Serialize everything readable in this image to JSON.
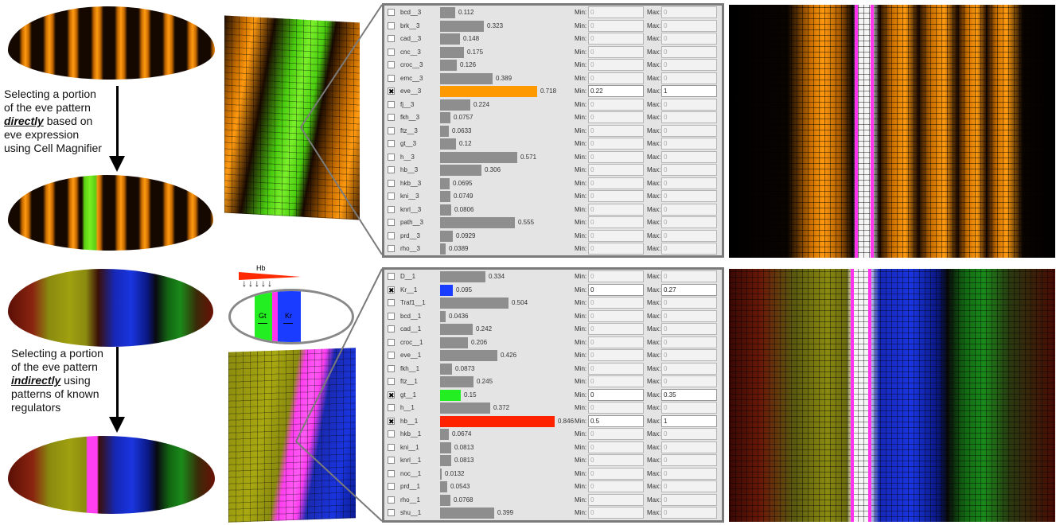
{
  "colors": {
    "orange": "#ff9900",
    "blue": "#1a3cff",
    "green": "#22ee22",
    "red": "#ff2200",
    "magenta": "#ff33ee",
    "bar_gray": "#8e8e8e"
  },
  "captions": {
    "top": {
      "line1": "Selecting a portion",
      "line2": "of the eve pattern",
      "emph": "directly",
      "line3_rest": " based on",
      "line4": "eve expression",
      "line5": "using Cell Magnifier"
    },
    "bottom": {
      "line1": "Selecting a portion",
      "line2": "of the eve pattern",
      "emph": "indirectly",
      "line3_rest": " using",
      "line4": "patterns of known",
      "line5": "regulators"
    }
  },
  "schematic": {
    "gradient_label": "Hb",
    "gt_label": "Gt",
    "kr_label": "Kr"
  },
  "panel_top": {
    "min_label": "Min:",
    "max_label": "Max:",
    "rows": [
      {
        "name": "bcd__3",
        "value": "0.112",
        "checked": "",
        "min": "0",
        "max": "0"
      },
      {
        "name": "brk__3",
        "value": "0.323",
        "checked": "",
        "min": "0",
        "max": "0"
      },
      {
        "name": "cad__3",
        "value": "0.148",
        "checked": "",
        "min": "0",
        "max": "0"
      },
      {
        "name": "cnc__3",
        "value": "0.175",
        "checked": "",
        "min": "0",
        "max": "0"
      },
      {
        "name": "croc__3",
        "value": "0.126",
        "checked": "",
        "min": "0",
        "max": "0"
      },
      {
        "name": "emc__3",
        "value": "0.389",
        "checked": "",
        "min": "0",
        "max": "0"
      },
      {
        "name": "eve__3",
        "value": "0.718",
        "checked": "✖",
        "min": "0.22",
        "max": "1",
        "color": "#ff9900"
      },
      {
        "name": "fj__3",
        "value": "0.224",
        "checked": "",
        "min": "0",
        "max": "0"
      },
      {
        "name": "fkh__3",
        "value": "0.0757",
        "checked": "",
        "min": "0",
        "max": "0"
      },
      {
        "name": "ftz__3",
        "value": "0.0633",
        "checked": "",
        "min": "0",
        "max": "0"
      },
      {
        "name": "gt__3",
        "value": "0.12",
        "checked": "",
        "min": "0",
        "max": "0"
      },
      {
        "name": "h__3",
        "value": "0.571",
        "checked": "",
        "min": "0",
        "max": "0"
      },
      {
        "name": "hb__3",
        "value": "0.306",
        "checked": "",
        "min": "0",
        "max": "0"
      },
      {
        "name": "hkb__3",
        "value": "0.0695",
        "checked": "",
        "min": "0",
        "max": "0"
      },
      {
        "name": "kni__3",
        "value": "0.0749",
        "checked": "",
        "min": "0",
        "max": "0"
      },
      {
        "name": "knrl__3",
        "value": "0.0806",
        "checked": "",
        "min": "0",
        "max": "0"
      },
      {
        "name": "path__3",
        "value": "0.555",
        "checked": "",
        "min": "0",
        "max": "0"
      },
      {
        "name": "prd__3",
        "value": "0.0929",
        "checked": "",
        "min": "0",
        "max": "0"
      },
      {
        "name": "rho__3",
        "value": "0.0389",
        "checked": "",
        "min": "0",
        "max": "0"
      }
    ]
  },
  "panel_bottom": {
    "min_label": "Min:",
    "max_label": "Max:",
    "rows": [
      {
        "name": "D__1",
        "value": "0.334",
        "checked": "",
        "min": "0",
        "max": "0"
      },
      {
        "name": "Kr__1",
        "value": "0.095",
        "checked": "✖",
        "min": "0",
        "max": "0.27",
        "color": "#1a3cff"
      },
      {
        "name": "Traf1__1",
        "value": "0.504",
        "checked": "",
        "min": "0",
        "max": "0"
      },
      {
        "name": "bcd__1",
        "value": "0.0436",
        "checked": "",
        "min": "0",
        "max": "0"
      },
      {
        "name": "cad__1",
        "value": "0.242",
        "checked": "",
        "min": "0",
        "max": "0"
      },
      {
        "name": "croc__1",
        "value": "0.206",
        "checked": "",
        "min": "0",
        "max": "0"
      },
      {
        "name": "eve__1",
        "value": "0.426",
        "checked": "",
        "min": "0",
        "max": "0"
      },
      {
        "name": "fkh__1",
        "value": "0.0873",
        "checked": "",
        "min": "0",
        "max": "0"
      },
      {
        "name": "ftz__1",
        "value": "0.245",
        "checked": "",
        "min": "0",
        "max": "0"
      },
      {
        "name": "gt__1",
        "value": "0.15",
        "checked": "✖",
        "min": "0",
        "max": "0.35",
        "color": "#22ee22"
      },
      {
        "name": "h__1",
        "value": "0.372",
        "checked": "",
        "min": "0",
        "max": "0"
      },
      {
        "name": "hb__1",
        "value": "0.846",
        "checked": "✖",
        "min": "0.5",
        "max": "1",
        "color": "#ff2200"
      },
      {
        "name": "hkb__1",
        "value": "0.0674",
        "checked": "",
        "min": "0",
        "max": "0"
      },
      {
        "name": "kni__1",
        "value": "0.0813",
        "checked": "",
        "min": "0",
        "max": "0"
      },
      {
        "name": "knrl__1",
        "value": "0.0813",
        "checked": "",
        "min": "0",
        "max": "0"
      },
      {
        "name": "noc__1",
        "value": "0.0132",
        "checked": "",
        "min": "0",
        "max": "0"
      },
      {
        "name": "prd__1",
        "value": "0.0543",
        "checked": "",
        "min": "0",
        "max": "0"
      },
      {
        "name": "rho__1",
        "value": "0.0768",
        "checked": "",
        "min": "0",
        "max": "0"
      },
      {
        "name": "shu__1",
        "value": "0.399",
        "checked": "",
        "min": "0",
        "max": "0"
      }
    ]
  }
}
